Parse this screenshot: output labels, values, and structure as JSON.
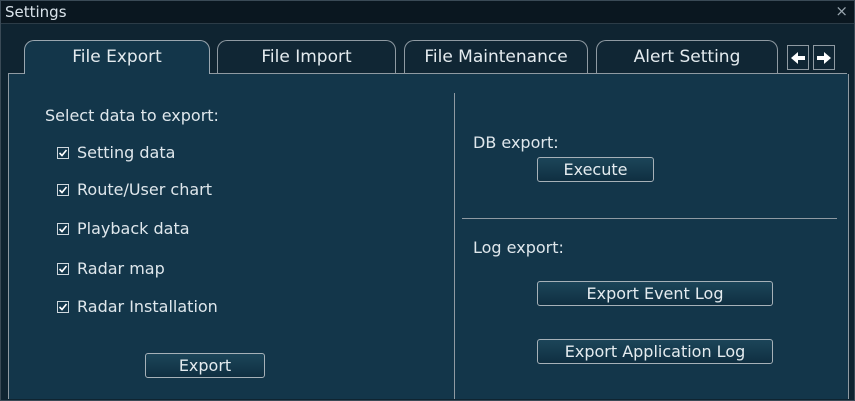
{
  "window": {
    "title": "Settings",
    "close_glyph": "×"
  },
  "tabs": [
    {
      "label": "File Export",
      "active": true
    },
    {
      "label": "File Import",
      "active": false
    },
    {
      "label": "File Maintenance",
      "active": false
    },
    {
      "label": "Alert Setting",
      "active": false
    }
  ],
  "tab_nav": {
    "prev_glyph": "🡐",
    "next_glyph": "🡒",
    "prev_icon": "arrow-left-icon",
    "next_icon": "arrow-right-icon"
  },
  "left": {
    "heading": "Select data to export:",
    "checkboxes": [
      {
        "label": "Setting data",
        "checked": true
      },
      {
        "label": "Route/User chart",
        "checked": true
      },
      {
        "label": "Playback data",
        "checked": true
      },
      {
        "label": "Radar map",
        "checked": true
      },
      {
        "label": "Radar Installation",
        "checked": true
      }
    ],
    "export_button": "Export"
  },
  "right": {
    "db_heading": "DB export:",
    "execute_button": "Execute",
    "log_heading": "Log export:",
    "export_event_log_button": "Export Event Log",
    "export_application_log_button": "Export Application Log"
  },
  "colors": {
    "background": "#0b1a24",
    "panel": "#13364a",
    "border": "#8f9aa2",
    "text": "#dfe7ec"
  }
}
